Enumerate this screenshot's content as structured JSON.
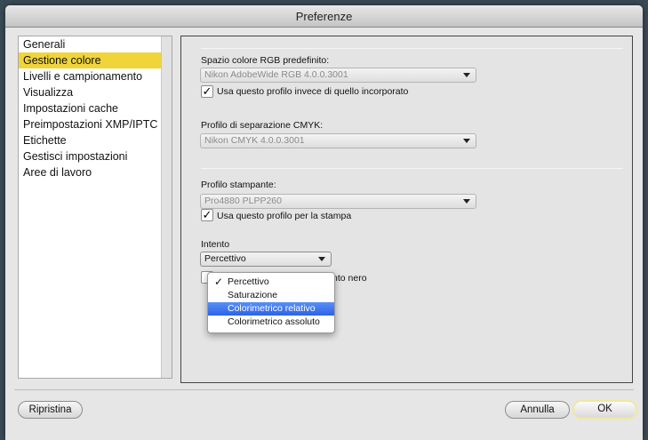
{
  "window": {
    "title": "Preferenze"
  },
  "sidebar": {
    "items": [
      {
        "label": "Generali"
      },
      {
        "label": "Gestione colore"
      },
      {
        "label": "Livelli e campionamento"
      },
      {
        "label": "Visualizza"
      },
      {
        "label": "Impostazioni cache"
      },
      {
        "label": "Preimpostazioni XMP/IPTC"
      },
      {
        "label": "Etichette"
      },
      {
        "label": "Gestisci impostazioni"
      },
      {
        "label": "Aree di lavoro"
      }
    ],
    "selected_index": 1
  },
  "color_management": {
    "rgb_label": "Spazio colore RGB predefinito:",
    "rgb_value": "Nikon AdobeWide RGB 4.0.0.3001",
    "rgb_checkbox_label": "Usa questo profilo invece di quello incorporato",
    "rgb_checkbox_checked": true,
    "cmyk_label": "Profilo di separazione CMYK:",
    "cmyk_value": "Nikon CMYK 4.0.0.3001",
    "printer_label": "Profilo stampante:",
    "printer_value": "Pro4880 PLPP260",
    "printer_checkbox_label": "Usa questo profilo per la stampa",
    "printer_checkbox_checked": true,
    "intent_label": "Intento",
    "intent_value": "Percettivo",
    "black_point_label_partial": "nto nero",
    "check_glyph": "✓"
  },
  "intent_menu": {
    "options": [
      {
        "label": "Percettivo",
        "checked": true
      },
      {
        "label": "Saturazione",
        "checked": false
      },
      {
        "label": "Colorimetrico relativo",
        "checked": false
      },
      {
        "label": "Colorimetrico assoluto",
        "checked": false
      }
    ],
    "highlighted_index": 2
  },
  "footer": {
    "reset_label": "Ripristina",
    "cancel_label": "Annulla",
    "ok_label": "OK"
  },
  "colors": {
    "selection": "#f0d43a",
    "menu_highlight": "#2c63e8"
  }
}
